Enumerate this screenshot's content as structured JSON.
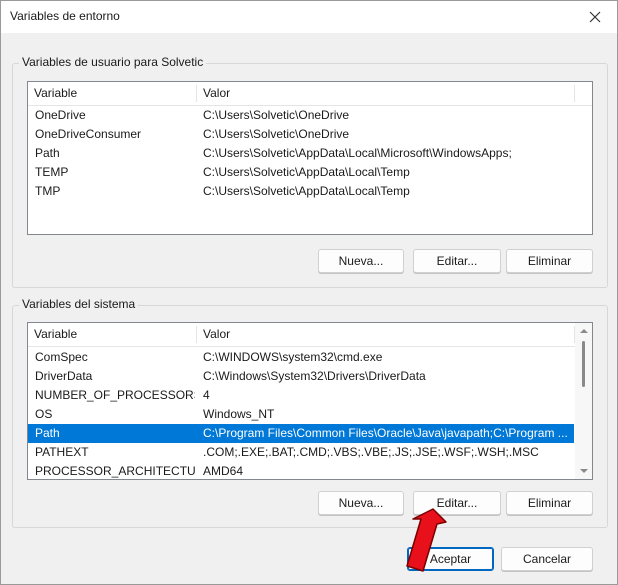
{
  "window": {
    "title": "Variables de entorno",
    "close_icon": "close-icon"
  },
  "user_vars": {
    "legend": "Variables de usuario para Solvetic",
    "columns": {
      "variable": "Variable",
      "value": "Valor"
    },
    "rows": [
      {
        "variable": "OneDrive",
        "value": "C:\\Users\\Solvetic\\OneDrive"
      },
      {
        "variable": "OneDriveConsumer",
        "value": "C:\\Users\\Solvetic\\OneDrive"
      },
      {
        "variable": "Path",
        "value": "C:\\Users\\Solvetic\\AppData\\Local\\Microsoft\\WindowsApps;"
      },
      {
        "variable": "TEMP",
        "value": "C:\\Users\\Solvetic\\AppData\\Local\\Temp"
      },
      {
        "variable": "TMP",
        "value": "C:\\Users\\Solvetic\\AppData\\Local\\Temp"
      }
    ],
    "buttons": {
      "new": "Nueva...",
      "edit": "Editar...",
      "delete": "Eliminar"
    }
  },
  "system_vars": {
    "legend": "Variables del sistema",
    "columns": {
      "variable": "Variable",
      "value": "Valor"
    },
    "rows": [
      {
        "variable": "ComSpec",
        "value": "C:\\WINDOWS\\system32\\cmd.exe"
      },
      {
        "variable": "DriverData",
        "value": "C:\\Windows\\System32\\Drivers\\DriverData"
      },
      {
        "variable": "NUMBER_OF_PROCESSORS",
        "value": "4"
      },
      {
        "variable": "OS",
        "value": "Windows_NT"
      },
      {
        "variable": "Path",
        "value": "C:\\Program Files\\Common Files\\Oracle\\Java\\javapath;C:\\Program ..."
      },
      {
        "variable": "PATHEXT",
        "value": ".COM;.EXE;.BAT;.CMD;.VBS;.VBE;.JS;.JSE;.WSF;.WSH;.MSC"
      },
      {
        "variable": "PROCESSOR_ARCHITECTURE",
        "value": "AMD64"
      }
    ],
    "selected_row": "Path",
    "buttons": {
      "new": "Nueva...",
      "edit": "Editar...",
      "delete": "Eliminar"
    }
  },
  "footer": {
    "ok": "Aceptar",
    "cancel": "Cancelar"
  },
  "colors": {
    "selection": "#0078d7",
    "annotation_arrow": "#e8101a"
  }
}
